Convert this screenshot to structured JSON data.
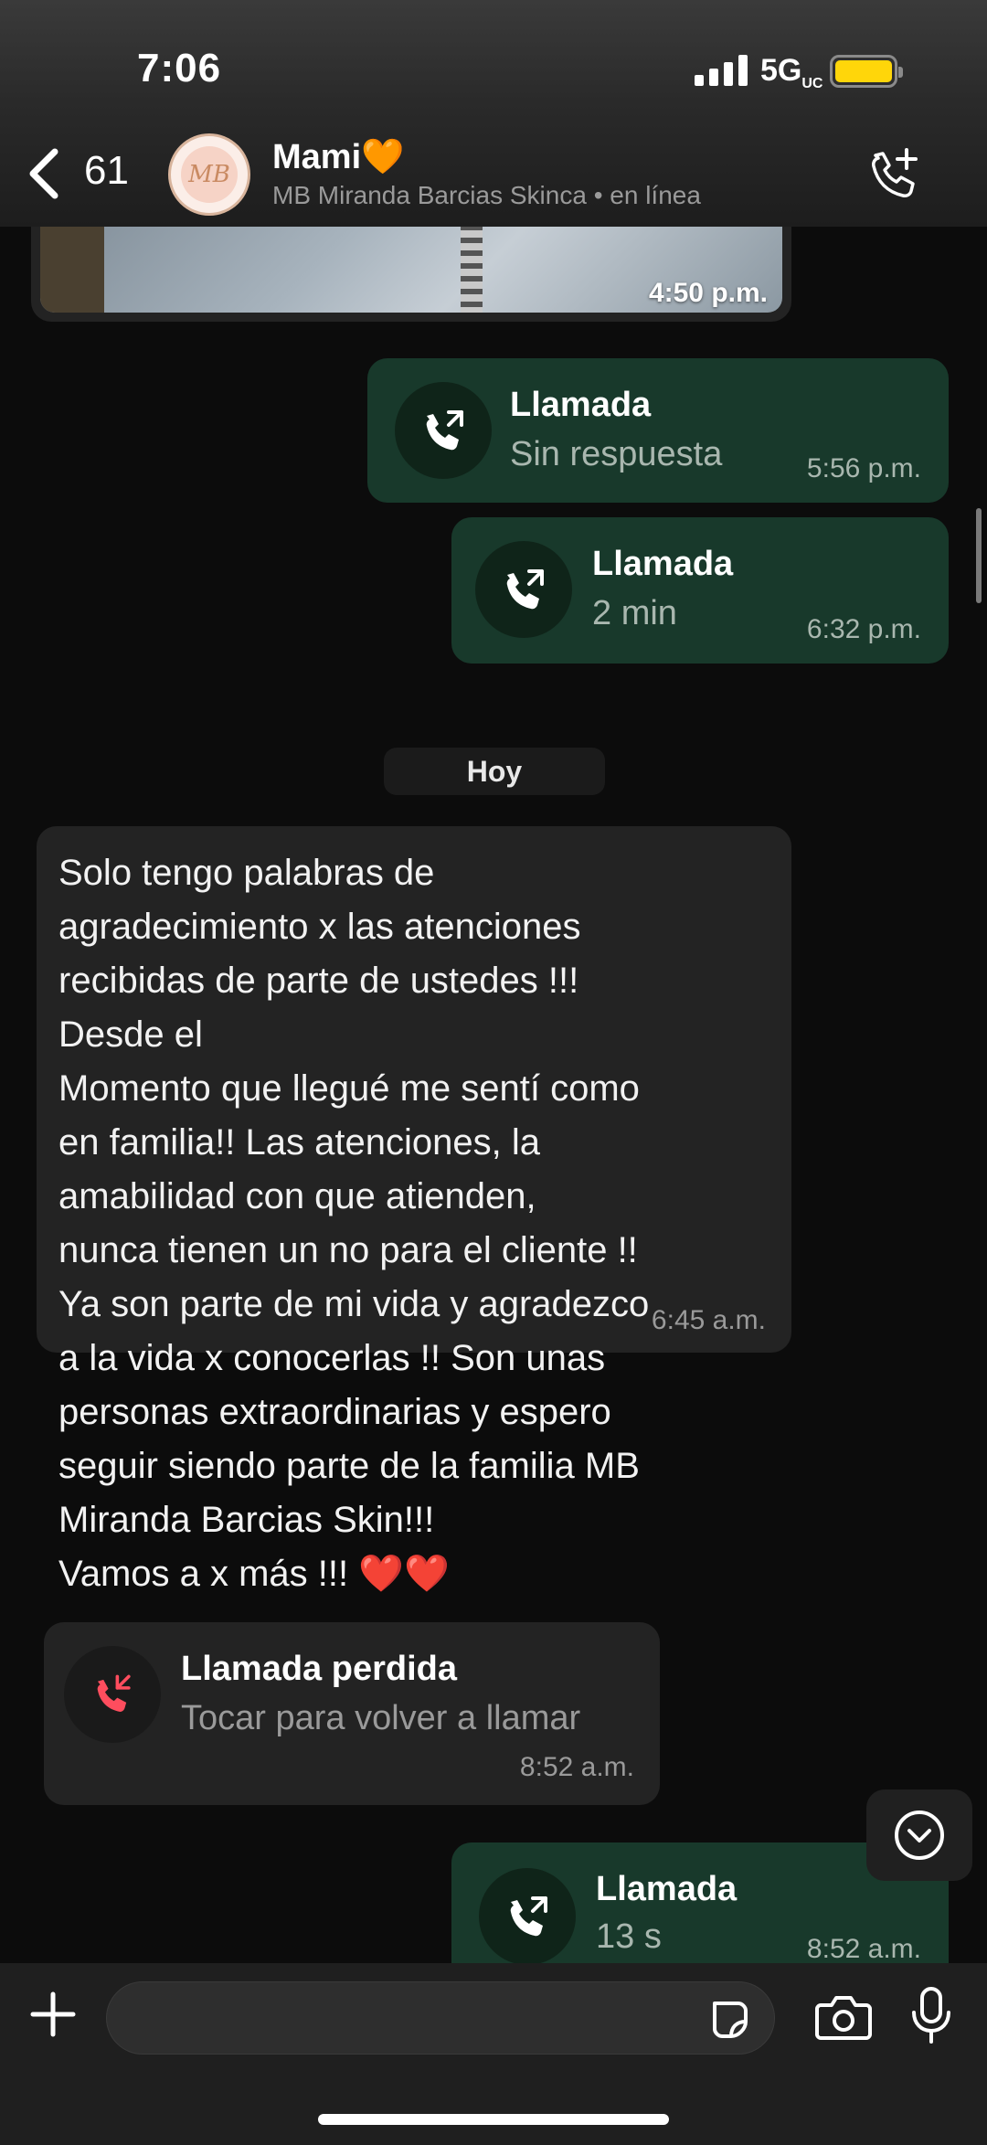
{
  "status_bar": {
    "time": "7:06",
    "network": "5G",
    "network_suffix": "UC"
  },
  "header": {
    "back_count": "61",
    "avatar_initials": "MB",
    "contact_name": "Mami🧡",
    "contact_business": "MB Miranda Barcias Skinca",
    "contact_status": "• en línea"
  },
  "messages": {
    "photo_time": "4:50 p.m.",
    "call_1": {
      "title": "Llamada",
      "subtitle": "Sin respuesta",
      "time": "5:56 p.m."
    },
    "call_2": {
      "title": "Llamada",
      "subtitle": "2 min",
      "time": "6:32 p.m."
    },
    "day_separator": "Hoy",
    "text_msg": {
      "text": "Solo tengo palabras de\nagradecimiento x las atenciones\nrecibidas de parte de ustedes !!!\nDesde el\nMomento que llegué me sentí como\nen familia!! Las atenciones, la\namabilidad con que atienden,\nnunca tienen un no para el cliente !!\nYa son parte de mi vida y agradezco\na la vida x conocerlas !! Son unas\npersonas extraordinarias y espero\nseguir siendo parte de la familia MB\nMiranda Barcias Skin!!!\nVamos a x más !!! ❤️❤️",
      "time": "6:45 a.m."
    },
    "missed_call": {
      "title": "Llamada perdida",
      "subtitle": "Tocar para volver a llamar",
      "time": "8:52 a.m."
    },
    "call_3": {
      "title": "Llamada",
      "subtitle": "13 s",
      "time": "8:52 a.m."
    }
  },
  "composer": {
    "placeholder": ""
  },
  "colors": {
    "outgoing_bubble": "#18392b",
    "incoming_bubble": "#232323",
    "missed_call_icon": "#ff4d5e",
    "battery": "#ffd60a"
  },
  "icons": [
    "back-icon",
    "call-add-icon",
    "outgoing-call-icon",
    "missed-call-icon",
    "chevron-down-icon",
    "plus-icon",
    "sticker-icon",
    "camera-icon",
    "mic-icon"
  ]
}
